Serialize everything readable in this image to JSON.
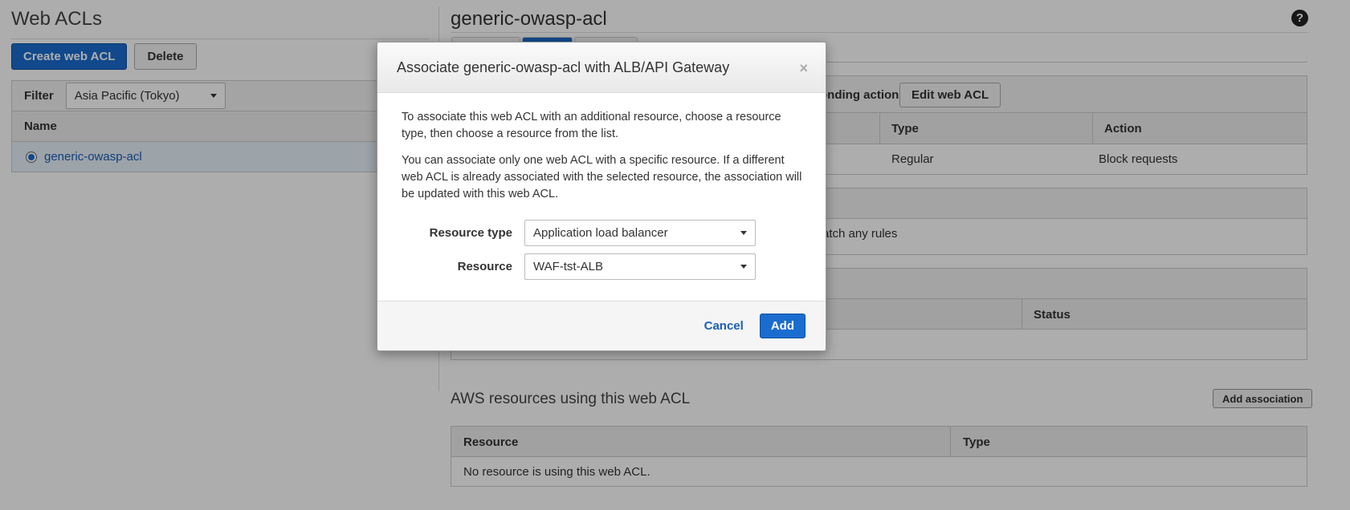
{
  "left": {
    "title": "Web ACLs",
    "create_label": "Create web ACL",
    "delete_label": "Delete",
    "filter_label": "Filter",
    "filter_value": "Asia Pacific (Tokyo)",
    "name_header": "Name",
    "acl_name": "generic-owasp-acl"
  },
  "right": {
    "title": "generic-owasp-acl",
    "help_glyph": "?",
    "rules_partial_label": "onding action",
    "edit_label": "Edit web ACL",
    "rules_columns": [
      "Type",
      "Action"
    ],
    "rules_row": [
      "Regular",
      "Block requests"
    ],
    "default_partial": "atch any rules",
    "status_header": "Status",
    "aws_section_title": "AWS resources using this web ACL",
    "add_association_label": "Add association",
    "resources_columns": [
      "Resource",
      "Type"
    ],
    "no_resource_text": "No resource is using this web ACL."
  },
  "modal": {
    "title": "Associate generic-owasp-acl with ALB/API Gateway",
    "close_glyph": "×",
    "para1": "To associate this web ACL with an additional resource, choose a resource type, then choose a resource from the list.",
    "para2": "You can associate only one web ACL with a specific resource. If a different web ACL is already associated with the selected resource, the association will be updated with this web ACL.",
    "resource_type_label": "Resource type",
    "resource_type_value": "Application load balancer",
    "resource_label": "Resource",
    "resource_value": "WAF-tst-ALB",
    "cancel_label": "Cancel",
    "add_label": "Add"
  },
  "colors": {
    "primary": "#1a6ccf",
    "link": "#1a5fb4",
    "overlay": "rgba(0,0,0,0.32)"
  }
}
